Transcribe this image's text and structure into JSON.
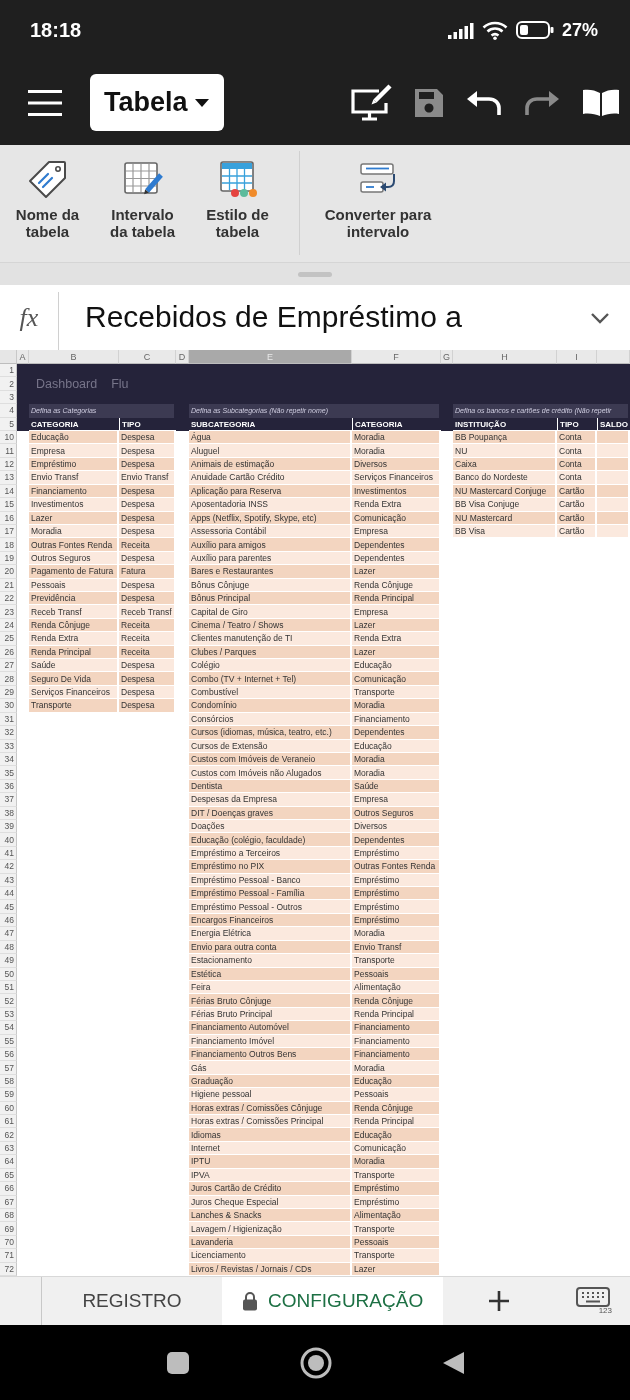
{
  "status_bar": {
    "time": "18:18",
    "battery": "27%"
  },
  "app_bar": {
    "title": "Tabela",
    "actions": [
      {
        "kind": "draw",
        "disabled": false
      },
      {
        "kind": "save",
        "disabled": true
      },
      {
        "kind": "undo",
        "disabled": false
      },
      {
        "kind": "redo",
        "disabled": true
      },
      {
        "kind": "reader",
        "disabled": false
      }
    ]
  },
  "ribbon": {
    "buttons": [
      {
        "kind": "name",
        "label": "Nome da tabela"
      },
      {
        "kind": "range",
        "label": "Intervalo da tabela"
      },
      {
        "kind": "style",
        "label": "Estilo de tabela"
      },
      {
        "kind": "convert",
        "label": "Converter para intervalo"
      }
    ]
  },
  "formula_bar": {
    "label": "fx",
    "value": "Recebidos de Empréstimo a"
  },
  "sheet": {
    "columns": [
      {
        "letter": "A",
        "selected": false
      },
      {
        "letter": "B",
        "selected": false
      },
      {
        "letter": "C",
        "selected": false
      },
      {
        "letter": "D",
        "selected": false
      },
      {
        "letter": "E",
        "selected": true
      },
      {
        "letter": "F",
        "selected": false
      },
      {
        "letter": "G",
        "selected": false
      },
      {
        "letter": "H",
        "selected": false
      },
      {
        "letter": "I",
        "selected": false
      }
    ],
    "row_numbers": [
      "1",
      "2",
      "3",
      "4",
      "5",
      "10",
      "11",
      "12",
      "13",
      "14",
      "15",
      "16",
      "17",
      "18",
      "19",
      "20",
      "21",
      "22",
      "23",
      "24",
      "25",
      "26",
      "27",
      "28",
      "29",
      "30",
      "31",
      "32",
      "33",
      "34",
      "35",
      "36",
      "37",
      "38",
      "39",
      "40",
      "41",
      "42",
      "43",
      "44",
      "45",
      "46",
      "47",
      "48",
      "49",
      "50",
      "51",
      "52",
      "53",
      "54",
      "55",
      "56",
      "57",
      "58",
      "59",
      "60",
      "61",
      "62",
      "63",
      "64",
      "65",
      "66",
      "67",
      "68",
      "69",
      "70",
      "71",
      "72"
    ],
    "nav_links": [
      "Dashboard",
      "Flu"
    ],
    "tables": [
      {
        "title": "Defina as Categorias",
        "columns": [
          "CATEGORIA",
          "TIPO"
        ],
        "rows": [
          [
            "Educação",
            "Despesa"
          ],
          [
            "Empresa",
            "Despesa"
          ],
          [
            "Empréstimo",
            "Despesa"
          ],
          [
            "Envio Transf",
            "Envio Transf"
          ],
          [
            "Financiamento",
            "Despesa"
          ],
          [
            "Investimentos",
            "Despesa"
          ],
          [
            "Lazer",
            "Despesa"
          ],
          [
            "Moradia",
            "Despesa"
          ],
          [
            "Outras Fontes Renda",
            "Receita"
          ],
          [
            "Outros Seguros",
            "Despesa"
          ],
          [
            "Pagamento de Fatura",
            "Fatura"
          ],
          [
            "Pessoais",
            "Despesa"
          ],
          [
            "Previdência",
            "Despesa"
          ],
          [
            "Receb Transf",
            "Receb Transf"
          ],
          [
            "Renda Cônjuge",
            "Receita"
          ],
          [
            "Renda Extra",
            "Receita"
          ],
          [
            "Renda Principal",
            "Receita"
          ],
          [
            "Saúde",
            "Despesa"
          ],
          [
            "Seguro De Vida",
            "Despesa"
          ],
          [
            "Serviços Financeiros",
            "Despesa"
          ],
          [
            "Transporte",
            "Despesa"
          ]
        ]
      },
      {
        "title": "Defina as Subcategorias (Não repetir nome)",
        "columns": [
          "SUBCATEGORIA",
          "CATEGORIA"
        ],
        "rows": [
          [
            "Água",
            "Moradia"
          ],
          [
            "Aluguel",
            "Moradia"
          ],
          [
            "Animais de estimação",
            "Diversos"
          ],
          [
            "Anuidade Cartão Crédito",
            "Serviços Financeiros"
          ],
          [
            "Aplicação para Reserva",
            "Investimentos"
          ],
          [
            "Aposentadoria INSS",
            "Renda Extra"
          ],
          [
            "Apps (Netflix, Spotify, Skype, etc)",
            "Comunicação"
          ],
          [
            "Assessoria Contábil",
            "Empresa"
          ],
          [
            "Auxílio para amigos",
            "Dependentes"
          ],
          [
            "Auxílio para parentes",
            "Dependentes"
          ],
          [
            "Bares e Restaurantes",
            "Lazer"
          ],
          [
            "Bônus Cônjuge",
            "Renda Cônjuge"
          ],
          [
            "Bônus Principal",
            "Renda Principal"
          ],
          [
            "Capital de Giro",
            "Empresa"
          ],
          [
            "Cinema / Teatro / Shows",
            "Lazer"
          ],
          [
            "Clientes manutenção de TI",
            "Renda Extra"
          ],
          [
            "Clubes / Parques",
            "Lazer"
          ],
          [
            "Colégio",
            "Educação"
          ],
          [
            "Combo (TV + Internet + Tel)",
            "Comunicação"
          ],
          [
            "Combustível",
            "Transporte"
          ],
          [
            "Condomínio",
            "Moradia"
          ],
          [
            "Consórcios",
            "Financiamento"
          ],
          [
            "Cursos (idiomas, música, teatro, etc.)",
            "Dependentes"
          ],
          [
            "Cursos de Extensão",
            "Educação"
          ],
          [
            "Custos com Imóveis de Veraneio",
            "Moradia"
          ],
          [
            "Custos com Imóveis não Alugados",
            "Moradia"
          ],
          [
            "Dentista",
            "Saúde"
          ],
          [
            "Despesas da Empresa",
            "Empresa"
          ],
          [
            "DIT / Doenças graves",
            "Outros Seguros"
          ],
          [
            "Doações",
            "Diversos"
          ],
          [
            "Educação (colégio, faculdade)",
            "Dependentes"
          ],
          [
            "Empréstimo a Terceiros",
            "Empréstimo"
          ],
          [
            "Empréstimo no PIX",
            "Outras Fontes Renda"
          ],
          [
            "Empréstimo Pessoal - Banco",
            "Empréstimo"
          ],
          [
            "Empréstimo Pessoal - Família",
            "Empréstimo"
          ],
          [
            "Empréstimo Pessoal - Outros",
            "Empréstimo"
          ],
          [
            "Encargos Financeiros",
            "Empréstimo"
          ],
          [
            "Energia Elétrica",
            "Moradia"
          ],
          [
            "Envio para outra conta",
            "Envio Transf"
          ],
          [
            "Estacionamento",
            "Transporte"
          ],
          [
            "Estética",
            "Pessoais"
          ],
          [
            "Feira",
            "Alimentação"
          ],
          [
            "Férias Bruto Cônjuge",
            "Renda Cônjuge"
          ],
          [
            "Férias Bruto Principal",
            "Renda Principal"
          ],
          [
            "Financiamento Automóvel",
            "Financiamento"
          ],
          [
            "Financiamento Imóvel",
            "Financiamento"
          ],
          [
            "Financiamento Outros Bens",
            "Financiamento"
          ],
          [
            "Gás",
            "Moradia"
          ],
          [
            "Graduação",
            "Educação"
          ],
          [
            "Higiene pessoal",
            "Pessoais"
          ],
          [
            "Horas extras / Comissões Cônjuge",
            "Renda Cônjuge"
          ],
          [
            "Horas extras / Comissões Principal",
            "Renda Principal"
          ],
          [
            "Idiomas",
            "Educação"
          ],
          [
            "Internet",
            "Comunicação"
          ],
          [
            "IPTU",
            "Moradia"
          ],
          [
            "IPVA",
            "Transporte"
          ],
          [
            "Juros Cartão de Crédito",
            "Empréstimo"
          ],
          [
            "Juros Cheque Especial",
            "Empréstimo"
          ],
          [
            "Lanches & Snacks",
            "Alimentação"
          ],
          [
            "Lavagem / Higienização",
            "Transporte"
          ],
          [
            "Lavanderia",
            "Pessoais"
          ],
          [
            "Licenciamento",
            "Transporte"
          ],
          [
            "Livros / Revistas / Jornais / CDs",
            "Lazer"
          ]
        ]
      },
      {
        "title": "Defina os bancos e cartões de crédito (Não repetir",
        "columns": [
          "INSTITUIÇÃO",
          "TIPO",
          "SALDO"
        ],
        "rows": [
          [
            "BB Poupança",
            "Conta"
          ],
          [
            "NU",
            "Conta"
          ],
          [
            "Caixa",
            "Conta"
          ],
          [
            "Banco do Nordeste",
            "Conta"
          ],
          [
            "NU Mastercard Conjuge",
            "Cartão"
          ],
          [
            "BB Visa Conjuge",
            "Cartão"
          ],
          [
            "NU Mastercard",
            "Cartão"
          ],
          [
            "BB Visa",
            "Cartão"
          ]
        ]
      }
    ]
  },
  "sheet_tabs": [
    {
      "label": "REGISTRO",
      "selected": false,
      "locked": false
    },
    {
      "label": "CONFIGURAÇÃO",
      "selected": true,
      "locked": true
    }
  ],
  "keyboard_label": "123"
}
